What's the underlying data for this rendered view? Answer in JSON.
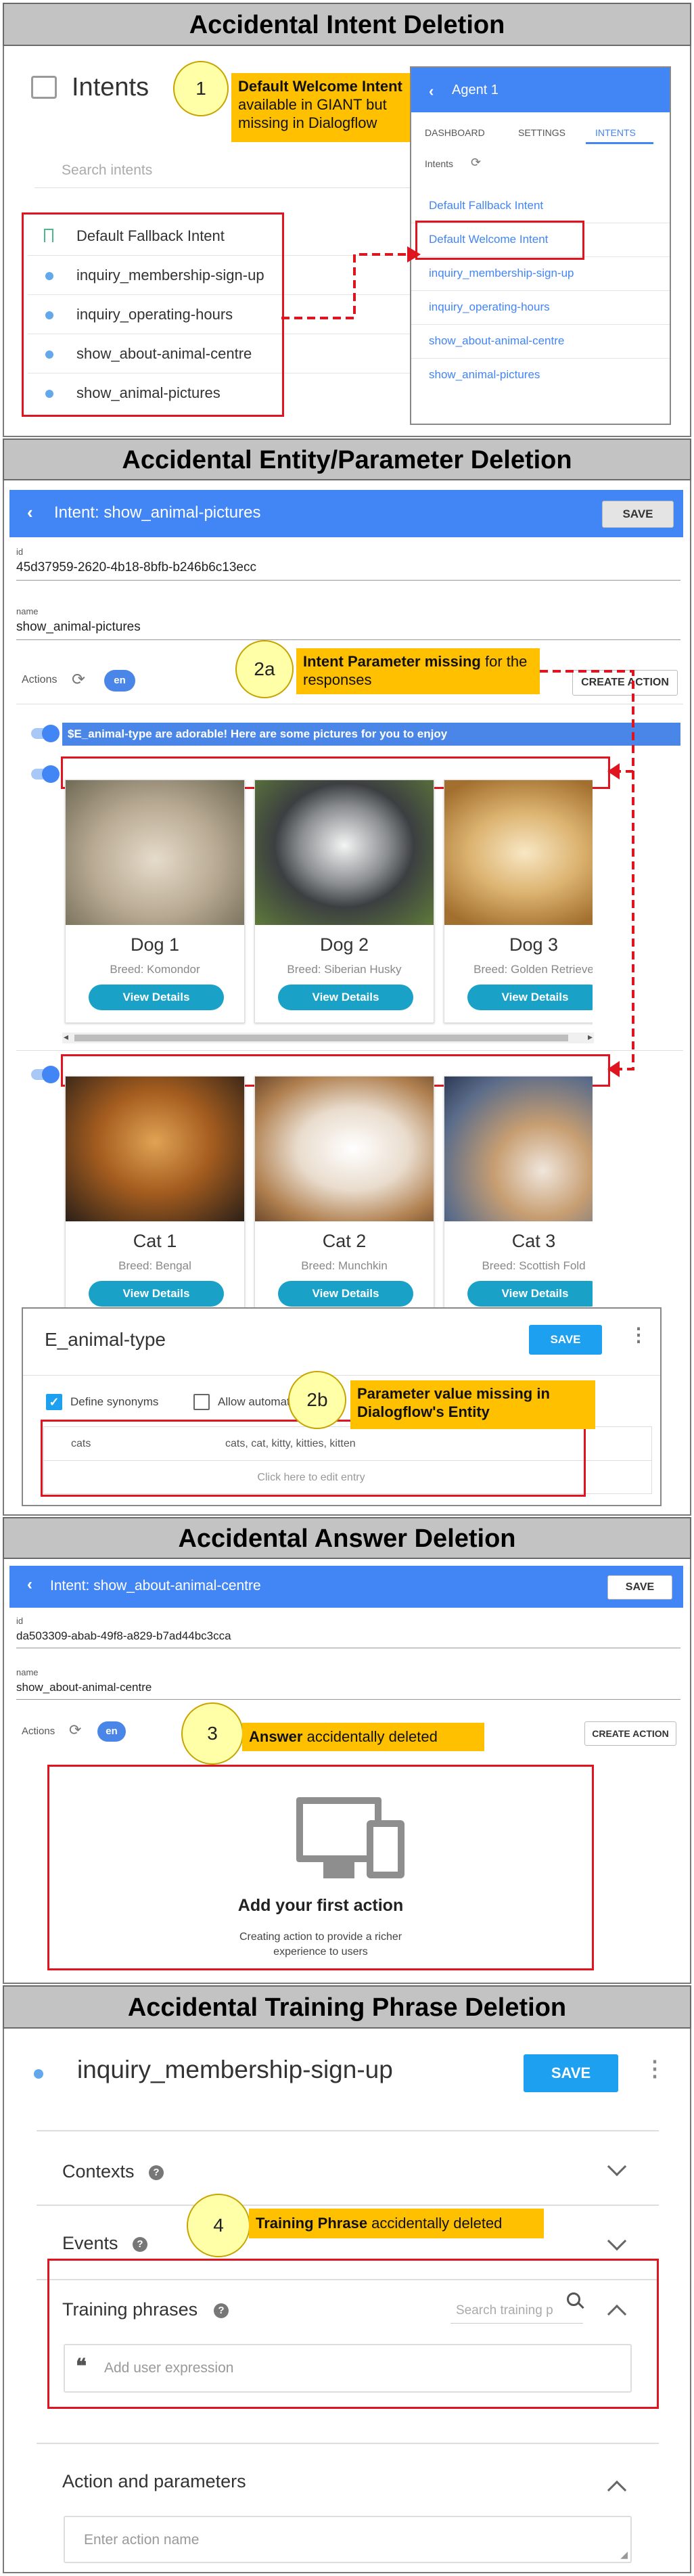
{
  "headers": {
    "s1": "Accidental Intent Deletion",
    "s2": "Accidental Entity/Parameter Deletion",
    "s3": "Accidental Answer Deletion",
    "s4": "Accidental Training Phrase Deletion"
  },
  "s1": {
    "title": "Intents",
    "search_placeholder": "Search intents",
    "intents": [
      "Default Fallback Intent",
      "inquiry_membership-sign-up",
      "inquiry_operating-hours",
      "show_about-animal-centre",
      "show_animal-pictures"
    ],
    "callout_num": "1",
    "callout_bold": "Default Welcome Intent",
    "callout_rest": " available in GIANT but missing in Dialogflow",
    "agent": {
      "title": "Agent 1",
      "tabs": [
        "DASHBOARD",
        "SETTINGS",
        "INTENTS"
      ],
      "sub": "Intents",
      "items": [
        "Default Fallback Intent",
        "Default Welcome Intent",
        "inquiry_membership-sign-up",
        "inquiry_operating-hours",
        "show_about-animal-centre",
        "show_animal-pictures"
      ]
    }
  },
  "s2": {
    "title": "Intent: show_animal-pictures",
    "save": "SAVE",
    "id_label": "id",
    "id_value": "45d37959-2620-4b18-8bfb-b246b6c13ecc",
    "name_label": "name",
    "name_value": "show_animal-pictures",
    "actions": "Actions",
    "lang": "en",
    "create_action": "CREATE ACTION",
    "callout_num": "2a",
    "callout_bold": "Intent Parameter missing",
    "callout_rest": " for the responses",
    "message": "$E_animal-type are adorable! Here are some pictures for you to enjoy",
    "dogs": [
      {
        "title": "Dog 1",
        "breed": "Breed: Komondor"
      },
      {
        "title": "Dog 2",
        "breed": "Breed: Siberian Husky"
      },
      {
        "title": "Dog 3",
        "breed": "Breed: Golden Retrieve"
      }
    ],
    "cats": [
      {
        "title": "Cat 1",
        "breed": "Breed: Bengal"
      },
      {
        "title": "Cat 2",
        "breed": "Breed: Munchkin"
      },
      {
        "title": "Cat 3",
        "breed": "Breed: Scottish Fold"
      }
    ],
    "view_details": "View Details",
    "entity": {
      "name": "E_animal-type",
      "save": "SAVE",
      "define_synonyms": "Define synonyms",
      "allow_auto": "Allow automati",
      "row_key": "cats",
      "row_syn": "cats, cat, kitty, kitties, kitten",
      "add_entry": "Click here to edit entry",
      "callout_num": "2b",
      "callout_line1": "Parameter value missing in",
      "callout_pre": "Dialogflow's ",
      "callout_bold": "Entity"
    }
  },
  "s3": {
    "title": "Intent: show_about-animal-centre",
    "save": "SAVE",
    "id_label": "id",
    "id_value": "da503309-abab-49f8-a829-b7ad44bc3cca",
    "name_label": "name",
    "name_value": "show_about-animal-centre",
    "actions": "Actions",
    "lang": "en",
    "create_action": "CREATE ACTION",
    "callout_num": "3",
    "callout_bold": "Answer",
    "callout_rest": " accidentally deleted",
    "empty_title": "Add your first action",
    "empty_desc": "Creating action to provide a richer experience to users"
  },
  "s4": {
    "intent_name": "inquiry_membership-sign-up",
    "save": "SAVE",
    "contexts": "Contexts",
    "events": "Events",
    "callout_num": "4",
    "callout_bold": "Training Phrase",
    "callout_rest": " accidentally deleted",
    "training": "Training phrases",
    "search_training": "Search training p",
    "add_expression": "Add user expression",
    "action_params": "Action and parameters",
    "action_placeholder": "Enter action name"
  },
  "colors": {
    "accent": "#4285f4",
    "callout": "#ffc000",
    "highlight": "#e0141e",
    "section_header": "#c3c3c3"
  }
}
